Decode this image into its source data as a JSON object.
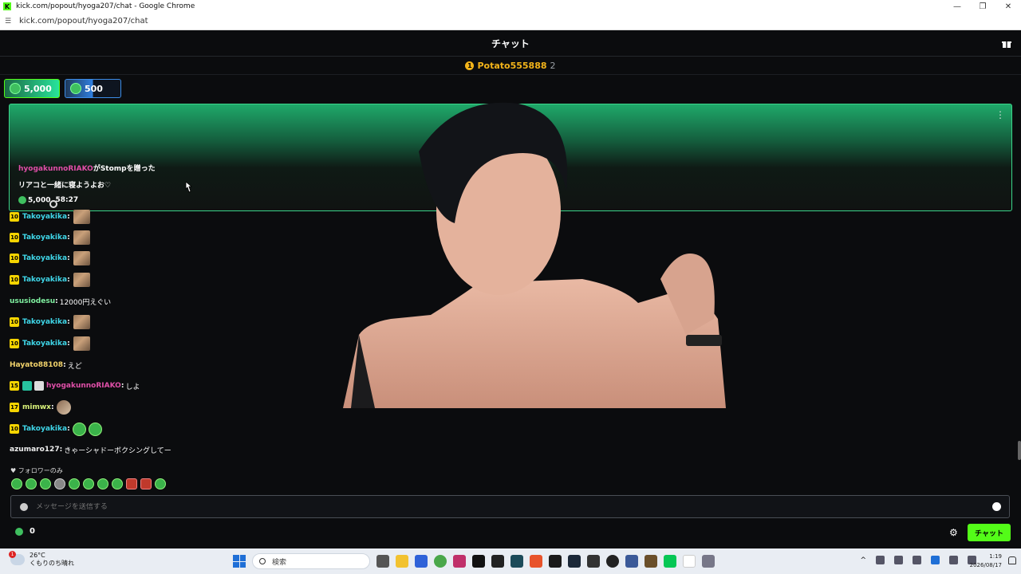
{
  "window": {
    "title": "kick.com/popout/hyoga207/chat - Google Chrome",
    "url": "kick.com/popout/hyoga207/chat",
    "logo_letter": "K",
    "controls": [
      "—",
      "❐",
      "✕"
    ]
  },
  "chat": {
    "header_title": "チャット",
    "pinned_user": {
      "name": "Potato555888",
      "count": "2",
      "crown_glyph": "1"
    },
    "gift_pills": [
      {
        "value": "5,000",
        "color": "#28e39b"
      },
      {
        "value": "500",
        "color": "#2f7fe0"
      }
    ],
    "highlight": {
      "sender": "hyogakunnoRIAKO",
      "action_suffix": "がStompを贈った",
      "message": "リアコと一緒に寝ようよお♡",
      "amount": "5,000",
      "time_left": "58:27",
      "menu_glyph": "⋮"
    },
    "messages": [
      {
        "badge": "10",
        "user": "Takoyakika",
        "sep": ":",
        "text": "",
        "emote": "brown"
      },
      {
        "badge": "10",
        "user": "Takoyakika",
        "sep": ":",
        "text": "",
        "emote": "brown"
      },
      {
        "badge": "10",
        "user": "Takoyakika",
        "sep": ":",
        "text": "",
        "emote": "brown"
      },
      {
        "badge": "10",
        "user": "Takoyakika",
        "sep": ":",
        "text": "",
        "emote": "brown"
      },
      {
        "badge": "",
        "user": "ususiodesu",
        "sep": ":",
        "text": "12000円えぐい",
        "emote": ""
      },
      {
        "badge": "10",
        "user": "Takoyakika",
        "sep": ":",
        "text": "",
        "emote": "brown"
      },
      {
        "badge": "10",
        "user": "Takoyakika",
        "sep": ":",
        "text": "",
        "emote": "brown"
      },
      {
        "badge": "",
        "user": "Hayato88108",
        "sep": ":",
        "text": "えど",
        "emote": ""
      },
      {
        "badge": "15",
        "user": "hyogakunnoRIAKO",
        "sep": ":",
        "text": "しよ",
        "emote": ""
      },
      {
        "badge": "17",
        "user": "mimwx",
        "sep": ":",
        "text": "",
        "emote": "cat"
      },
      {
        "badge": "10",
        "user": "Takoyakika",
        "sep": ":",
        "text": "",
        "emote": "green2"
      },
      {
        "badge": "",
        "user": "azumaro127",
        "sep": ":",
        "text": "きゃーシャドーボクシングしてー",
        "emote": ""
      }
    ],
    "follow_note": "♥ フォロワーのみ",
    "input_placeholder": "メッセージを送信する",
    "footer_points": "0",
    "settings_glyph": "⚙",
    "send_label": "チャット"
  },
  "taskbar": {
    "weather_temp": "26°C",
    "weather_desc": "くもりのち晴れ",
    "weather_alert": "1",
    "search_label": "検索",
    "time": "1:19",
    "date": "2026/08/17",
    "tray_expand": "^"
  },
  "colors": {
    "kick_green": "#53fc18",
    "username_cyan": "#3fd6e8",
    "username_pink": "#e04fa8",
    "crown_gold": "#f3b41a"
  }
}
